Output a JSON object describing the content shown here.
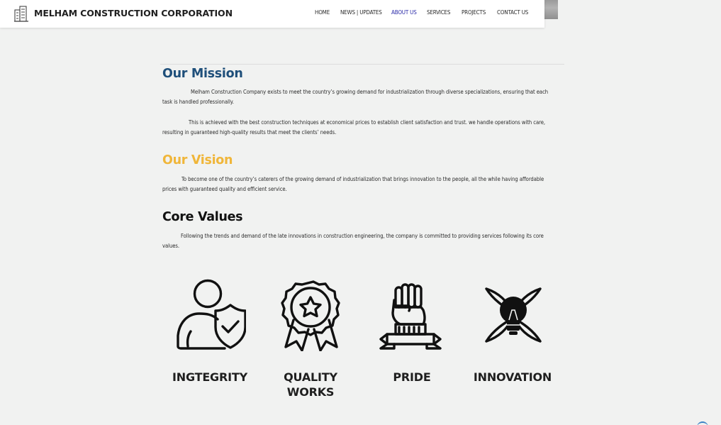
{
  "header": {
    "brand": "MELHAM CONSTRUCTION CORPORATION",
    "nav": [
      "HOME",
      "NEWS | UPDATES",
      "ABOUT US",
      "SERVICES",
      "PROJECTS",
      "CONTACT US"
    ],
    "active_nav": "ABOUT US"
  },
  "mission": {
    "title": "Our Mission",
    "paragraphs": [
      "Melham Construction Company exists to meet the country’s growing demand for industrialization through diverse specializations, ensuring that each task is handled professionally.",
      "This is achieved with the best construction techniques at economical prices to establish client satisfaction and trust. we handle operations with care, resulting in guaranteed high-quality results that meet the clients’ needs."
    ]
  },
  "vision": {
    "title": "Our Vision",
    "paragraph": "To become one of the country’s caterers of the growing demand of  industrialization that brings innovation to the people, all the while having affordable prices with guaranteed quality and efficient service."
  },
  "core": {
    "title": "Core Values",
    "paragraph": "Following the trends and demand of the late innovations in construction engineering, the company is committed to providing services following its core values.",
    "values": [
      {
        "label": "INGTEGRITY",
        "icon": "user-shield-icon"
      },
      {
        "label": "QUALITY WORKS",
        "icon": "award-badge-icon"
      },
      {
        "label": "PRIDE",
        "icon": "raised-fist-icon"
      },
      {
        "label": "INNOVATION",
        "icon": "lightbulb-rocket-icon"
      }
    ]
  },
  "colors": {
    "mission_title": "#1f4f7a",
    "vision_title": "#f0b63a",
    "active_nav": "#2a2aa8",
    "background": "#f1f2f1"
  }
}
